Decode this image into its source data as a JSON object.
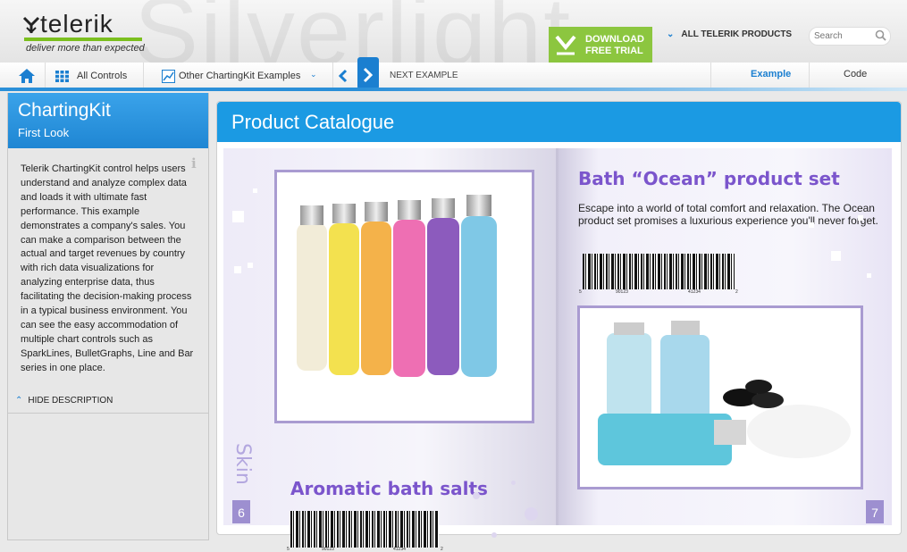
{
  "header": {
    "watermark": "Silverlight",
    "logo_text": "telerik",
    "logo_tagline": "deliver more than expected",
    "download_label_line1": "DOWNLOAD",
    "download_label_line2": "FREE TRIAL",
    "all_products_label": "ALL TELERIK PRODUCTS",
    "search_placeholder": "Search"
  },
  "nav": {
    "all_controls": "All Controls",
    "other_examples": "Other ChartingKit Examples",
    "next_example": "NEXT EXAMPLE",
    "tab_example": "Example",
    "tab_code": "Code"
  },
  "sidebar": {
    "title": "ChartingKit",
    "subtitle": "First Look",
    "description": "Telerik ChartingKit control helps users understand and analyze complex data and loads it with ultimate fast performance. This example demonstrates a company's sales. You can make a comparison between the actual and target revenues by country with rich data visualizations for analyzing enterprise data, thus facilitating the decision-making process in a typical business environment. You can see the easy accommodation of multiple chart controls such as SparkLines, BulletGraphs, Line and Bar series in one place.",
    "hide_description": "HIDE DESCRIPTION"
  },
  "panel": {
    "title": "Product Catalogue",
    "left_page": {
      "heading": "Aromatic bath salts",
      "skin_label": "Skin",
      "page_number": "6",
      "barcode_digits": [
        "5",
        "90123",
        "41234",
        "2"
      ]
    },
    "right_page": {
      "heading": "Bath “Ocean” product set",
      "body": "Escape into a world of total comfort and relaxation. The Ocean product set promises a luxurious experience you'll never forget.",
      "page_number": "7",
      "barcode_digits": [
        "5",
        "90123",
        "41234",
        "2"
      ]
    }
  },
  "colors": {
    "accent_blue": "#1b9ae3",
    "download_green": "#8cc63f",
    "heading_purple": "#7b55cc",
    "frame_purple": "#a99bd1"
  }
}
